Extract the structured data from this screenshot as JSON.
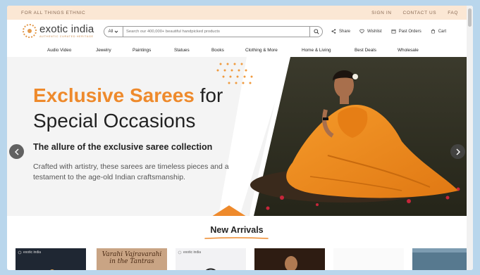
{
  "topbar": {
    "tagline": "FOR ALL THINGS ETHNIC",
    "links": [
      "SIGN IN",
      "CONTACT US",
      "FAQ"
    ]
  },
  "logo": {
    "name": "exotic india",
    "tagline": "AUTHENTIC CURATED HERITAGE"
  },
  "search": {
    "category": "All",
    "placeholder": "Search our 400,000+ beautiful handpicked products"
  },
  "actions": {
    "share": "Share",
    "wishlist": "Wishlist",
    "past_orders": "Past Orders",
    "cart": "Cart"
  },
  "nav": [
    "Audio Video",
    "Jewelry",
    "Paintings",
    "Statues",
    "Books",
    "Clothing & More",
    "Home & Living",
    "Best Deals",
    "Wholesale"
  ],
  "hero": {
    "title_highlight": "Exclusive Sarees",
    "title_rest": " for",
    "title_line2": "Special Occasions",
    "subtitle": "The allure of the exclusive saree collection",
    "description": "Crafted with artistry, these sarees are timeless pieces and a testament to the age-old Indian craftsmanship."
  },
  "new_arrivals": {
    "title": "New Arrivals",
    "product_labels": [
      "exotic india",
      "Varahi Vajravarahi in the Tantras",
      "exotic india"
    ]
  },
  "colors": {
    "accent": "#ee8a2c",
    "topbar_bg": "#fbe7d4",
    "page_bg": "#b9d6ec"
  },
  "icons": {
    "search": "search-icon",
    "share": "share-icon",
    "wishlist": "heart-icon",
    "past_orders": "orders-icon",
    "cart": "cart-icon",
    "prev": "chevron-left-icon",
    "next": "chevron-right-icon"
  }
}
